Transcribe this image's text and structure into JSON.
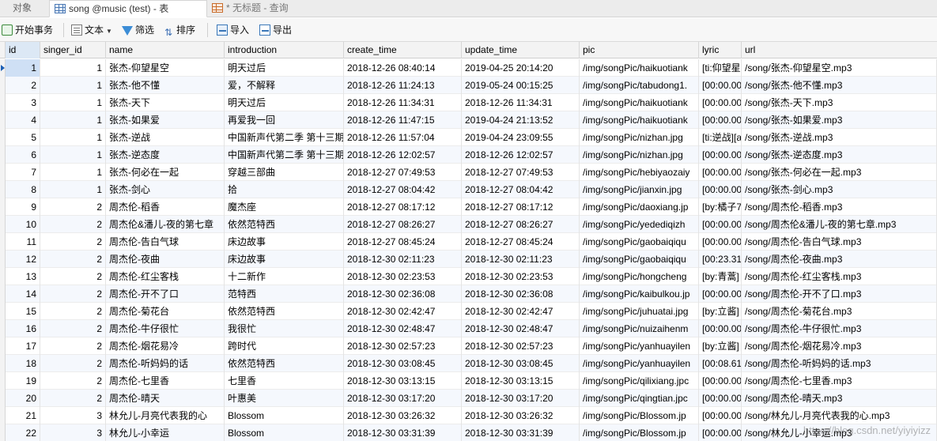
{
  "tabs": {
    "objects": "对象",
    "active": "song @music (test) - 表",
    "query": "* 无标题 - 查询"
  },
  "toolbar": {
    "begin_tx": "开始事务",
    "text": "文本",
    "filter": "筛选",
    "sort": "排序",
    "import": "导入",
    "export": "导出",
    "icons": [
      "transaction-icon",
      "text-icon",
      "filter-icon",
      "sort-icon",
      "import-icon",
      "export-icon"
    ]
  },
  "columns": [
    "id",
    "singer_id",
    "name",
    "introduction",
    "create_time",
    "update_time",
    "pic",
    "lyric",
    "url"
  ],
  "rows": [
    {
      "id": "1",
      "singer_id": "1",
      "name": "张杰-仰望星空",
      "introduction": "明天过后",
      "create_time": "2018-12-26 08:40:14",
      "update_time": "2019-04-25 20:14:20",
      "pic": "/img/songPic/haikuotiank",
      "lyric": "[ti:仰望星",
      "url": "/song/张杰-仰望星空.mp3"
    },
    {
      "id": "2",
      "singer_id": "1",
      "name": "张杰-他不懂",
      "introduction": "爱，不解释",
      "create_time": "2018-12-26 11:24:13",
      "update_time": "2019-05-24 00:15:25",
      "pic": "/img/songPic/tabudong1.",
      "lyric": "[00:00.00",
      "url": "/song/张杰-他不懂.mp3"
    },
    {
      "id": "3",
      "singer_id": "1",
      "name": "张杰-天下",
      "introduction": "明天过后",
      "create_time": "2018-12-26 11:34:31",
      "update_time": "2018-12-26 11:34:31",
      "pic": "/img/songPic/haikuotiank",
      "lyric": "[00:00.00",
      "url": "/song/张杰-天下.mp3"
    },
    {
      "id": "4",
      "singer_id": "1",
      "name": "张杰-如果爱",
      "introduction": "再爱我一回",
      "create_time": "2018-12-26 11:47:15",
      "update_time": "2019-04-24 21:13:52",
      "pic": "/img/songPic/haikuotiank",
      "lyric": "[00:00.00",
      "url": "/song/张杰-如果爱.mp3"
    },
    {
      "id": "5",
      "singer_id": "1",
      "name": "张杰-逆战",
      "introduction": "中国新声代第二季 第十三期",
      "create_time": "2018-12-26 11:57:04",
      "update_time": "2019-04-24 23:09:55",
      "pic": "/img/songPic/nizhan.jpg",
      "lyric": "[ti:逆战][a",
      "url": "/song/张杰-逆战.mp3"
    },
    {
      "id": "6",
      "singer_id": "1",
      "name": "张杰-逆态度",
      "introduction": "中国新声代第二季 第十三期",
      "create_time": "2018-12-26 12:02:57",
      "update_time": "2018-12-26 12:02:57",
      "pic": "/img/songPic/nizhan.jpg",
      "lyric": "[00:00.00",
      "url": "/song/张杰-逆态度.mp3"
    },
    {
      "id": "7",
      "singer_id": "1",
      "name": "张杰-何必在一起",
      "introduction": "穿越三部曲",
      "create_time": "2018-12-27 07:49:53",
      "update_time": "2018-12-27 07:49:53",
      "pic": "/img/songPic/hebiyaozaiy",
      "lyric": "[00:00.00",
      "url": "/song/张杰-何必在一起.mp3"
    },
    {
      "id": "8",
      "singer_id": "1",
      "name": "张杰-剑心",
      "introduction": "拾",
      "create_time": "2018-12-27 08:04:42",
      "update_time": "2018-12-27 08:04:42",
      "pic": "/img/songPic/jianxin.jpg",
      "lyric": "[00:00.00",
      "url": "/song/张杰-剑心.mp3"
    },
    {
      "id": "9",
      "singer_id": "2",
      "name": "周杰伦-稻香",
      "introduction": "魔杰座",
      "create_time": "2018-12-27 08:17:12",
      "update_time": "2018-12-27 08:17:12",
      "pic": "/img/songPic/daoxiang.jp",
      "lyric": "[by:橘子7",
      "url": "/song/周杰伦-稻香.mp3"
    },
    {
      "id": "10",
      "singer_id": "2",
      "name": "周杰伦&潘儿-夜的第七章",
      "introduction": "依然范特西",
      "create_time": "2018-12-27 08:26:27",
      "update_time": "2018-12-27 08:26:27",
      "pic": "/img/songPic/yedediqizh",
      "lyric": "[00:00.00",
      "url": "/song/周杰伦&潘儿-夜的第七章.mp3"
    },
    {
      "id": "11",
      "singer_id": "2",
      "name": "周杰伦-告白气球",
      "introduction": "床边故事",
      "create_time": "2018-12-27 08:45:24",
      "update_time": "2018-12-27 08:45:24",
      "pic": "/img/songPic/gaobaiqiqu",
      "lyric": "[00:00.00",
      "url": "/song/周杰伦-告白气球.mp3"
    },
    {
      "id": "12",
      "singer_id": "2",
      "name": "周杰伦-夜曲",
      "introduction": "床边故事",
      "create_time": "2018-12-30 02:11:23",
      "update_time": "2018-12-30 02:11:23",
      "pic": "/img/songPic/gaobaiqiqu",
      "lyric": "[00:23.31",
      "url": "/song/周杰伦-夜曲.mp3"
    },
    {
      "id": "13",
      "singer_id": "2",
      "name": "周杰伦-红尘客栈",
      "introduction": "十二新作",
      "create_time": "2018-12-30 02:23:53",
      "update_time": "2018-12-30 02:23:53",
      "pic": "/img/songPic/hongcheng",
      "lyric": "[by:青蒿]",
      "url": "/song/周杰伦-红尘客栈.mp3"
    },
    {
      "id": "14",
      "singer_id": "2",
      "name": "周杰伦-开不了口",
      "introduction": "范特西",
      "create_time": "2018-12-30 02:36:08",
      "update_time": "2018-12-30 02:36:08",
      "pic": "/img/songPic/kaibulkou.jp",
      "lyric": "[00:00.00",
      "url": "/song/周杰伦-开不了口.mp3"
    },
    {
      "id": "15",
      "singer_id": "2",
      "name": "周杰伦-菊花台",
      "introduction": "依然范特西",
      "create_time": "2018-12-30 02:42:47",
      "update_time": "2018-12-30 02:42:47",
      "pic": "/img/songPic/juhuatai.jpg",
      "lyric": "[by:立酱]",
      "url": "/song/周杰伦-菊花台.mp3"
    },
    {
      "id": "16",
      "singer_id": "2",
      "name": "周杰伦-牛仔很忙",
      "introduction": "我很忙",
      "create_time": "2018-12-30 02:48:47",
      "update_time": "2018-12-30 02:48:47",
      "pic": "/img/songPic/nuizaihenm",
      "lyric": "[00:00.00",
      "url": "/song/周杰伦-牛仔很忙.mp3"
    },
    {
      "id": "17",
      "singer_id": "2",
      "name": "周杰伦-烟花易冷",
      "introduction": "跨时代",
      "create_time": "2018-12-30 02:57:23",
      "update_time": "2018-12-30 02:57:23",
      "pic": "/img/songPic/yanhuayilen",
      "lyric": "[by:立酱]",
      "url": "/song/周杰伦-烟花易冷.mp3"
    },
    {
      "id": "18",
      "singer_id": "2",
      "name": "周杰伦-听妈妈的话",
      "introduction": "依然范特西",
      "create_time": "2018-12-30 03:08:45",
      "update_time": "2018-12-30 03:08:45",
      "pic": "/img/songPic/yanhuayilen",
      "lyric": "[00:08.61",
      "url": "/song/周杰伦-听妈妈的话.mp3"
    },
    {
      "id": "19",
      "singer_id": "2",
      "name": "周杰伦-七里香",
      "introduction": "七里香",
      "create_time": "2018-12-30 03:13:15",
      "update_time": "2018-12-30 03:13:15",
      "pic": "/img/songPic/qilixiang.jpc",
      "lyric": "[00:00.00",
      "url": "/song/周杰伦-七里香.mp3"
    },
    {
      "id": "20",
      "singer_id": "2",
      "name": "周杰伦-晴天",
      "introduction": "叶惠美",
      "create_time": "2018-12-30 03:17:20",
      "update_time": "2018-12-30 03:17:20",
      "pic": "/img/songPic/qingtian.jpc",
      "lyric": "[00:00.00",
      "url": "/song/周杰伦-晴天.mp3"
    },
    {
      "id": "21",
      "singer_id": "3",
      "name": "林允儿-月亮代表我的心",
      "introduction": "Blossom",
      "create_time": "2018-12-30 03:26:32",
      "update_time": "2018-12-30 03:26:32",
      "pic": "/img/songPic/Blossom.jp",
      "lyric": "[00:00.00",
      "url": "/song/林允儿-月亮代表我的心.mp3"
    },
    {
      "id": "22",
      "singer_id": "3",
      "name": "林允儿-小幸运",
      "introduction": "Blossom",
      "create_time": "2018-12-30 03:31:39",
      "update_time": "2018-12-30 03:31:39",
      "pic": "/img/songPic/Blossom.jp",
      "lyric": "[00:00.00",
      "url": "/song/林允儿-小幸运.mp3"
    }
  ],
  "watermark": "https://blog.csdn.net/yiyiyizz",
  "colors": {
    "accent": "#3c8dd6",
    "selected_header": "#dce8f5",
    "current_row_cell": "#cfe0f5"
  }
}
